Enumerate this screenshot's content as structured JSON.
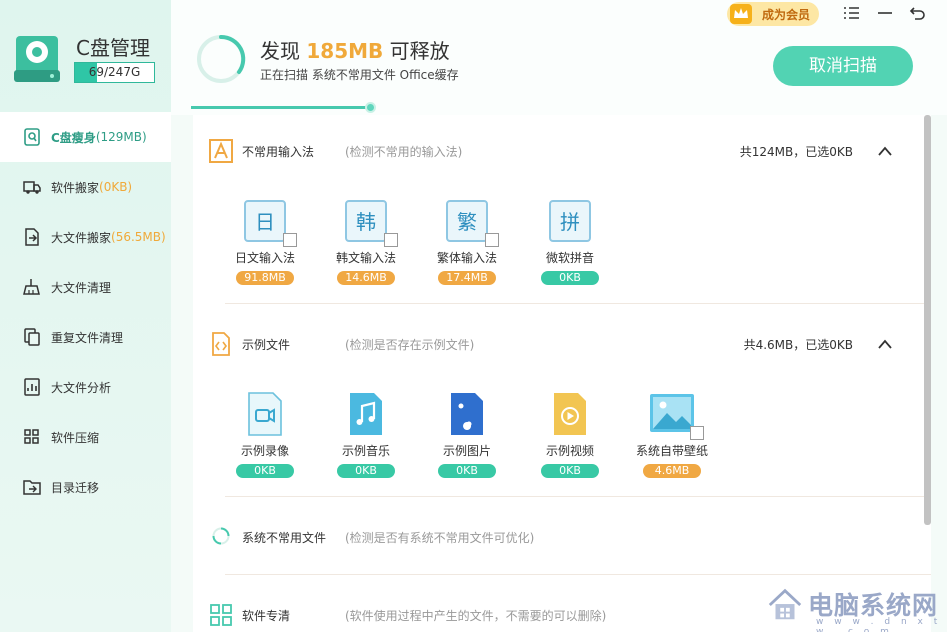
{
  "app": {
    "title": "C盘管理",
    "storage_text": "69/247G",
    "storage_used_fraction": 0.28
  },
  "sidebar": {
    "items": [
      {
        "label": "C盘瘦身",
        "highlight": "(129MB)",
        "active": true,
        "icon": "disk-clean-icon"
      },
      {
        "label": "软件搬家",
        "highlight": "(0KB)",
        "active": false,
        "icon": "truck-icon"
      },
      {
        "label": "大文件搬家",
        "highlight": "(56.5MB)",
        "active": false,
        "icon": "file-move-icon"
      },
      {
        "label": "大文件清理",
        "highlight": "",
        "active": false,
        "icon": "broom-icon"
      },
      {
        "label": "重复文件清理",
        "highlight": "",
        "active": false,
        "icon": "duplicate-icon"
      },
      {
        "label": "大文件分析",
        "highlight": "",
        "active": false,
        "icon": "file-analysis-icon"
      },
      {
        "label": "软件压缩",
        "highlight": "",
        "active": false,
        "icon": "compress-icon"
      },
      {
        "label": "目录迁移",
        "highlight": "",
        "active": false,
        "icon": "folder-move-icon"
      }
    ]
  },
  "header": {
    "found_prefix": "发现 ",
    "found_amount": "185MB",
    "found_suffix": " 可释放",
    "scanning_text": "正在扫描 系统不常用文件 Office缓存",
    "cancel_label": "取消扫描",
    "vip_label": "成为会员",
    "scan_progress": 1.0
  },
  "sections": [
    {
      "title": "不常用输入法",
      "desc": "(检测不常用的输入法)",
      "total": "共124MB，已选0KB",
      "icon": "letter-a-icon",
      "items": [
        {
          "glyph": "日",
          "name": "日文输入法",
          "size": "91.8MB",
          "color": "orange",
          "checkbox": true
        },
        {
          "glyph": "韩",
          "name": "韩文输入法",
          "size": "14.6MB",
          "color": "orange",
          "checkbox": true
        },
        {
          "glyph": "繁",
          "name": "繁体输入法",
          "size": "17.4MB",
          "color": "orange",
          "checkbox": true
        },
        {
          "glyph": "拼",
          "name": "微软拼音",
          "size": "0KB",
          "color": "green",
          "checkbox": false
        }
      ]
    },
    {
      "title": "示例文件",
      "desc": "(检测是否存在示例文件)",
      "total": "共4.6MB，已选0KB",
      "icon": "code-file-icon",
      "items": [
        {
          "name": "示例录像",
          "size": "0KB",
          "color": "green",
          "icon": "video-file-icon"
        },
        {
          "name": "示例音乐",
          "size": "0KB",
          "color": "green",
          "icon": "music-file-icon"
        },
        {
          "name": "示例图片",
          "size": "0KB",
          "color": "green",
          "icon": "image-file-icon"
        },
        {
          "name": "示例视频",
          "size": "0KB",
          "color": "green",
          "icon": "play-file-icon"
        },
        {
          "name": "系统自带壁纸",
          "size": "4.6MB",
          "color": "orange",
          "icon": "wallpaper-icon"
        }
      ]
    },
    {
      "title": "系统不常用文件",
      "desc": "(检测是否有系统不常用文件可优化)",
      "icon": "spinner-icon"
    },
    {
      "title": "软件专清",
      "desc": "(软件使用过程中产生的文件，不需要的可以删除)",
      "icon": "apps-grid-icon"
    }
  ],
  "watermark": {
    "title": "电脑系统网",
    "url": "w w w . d n x t w . c o m"
  },
  "colors": {
    "accent": "#47c9ae",
    "orange": "#f0a843",
    "green": "#38c9a5"
  }
}
